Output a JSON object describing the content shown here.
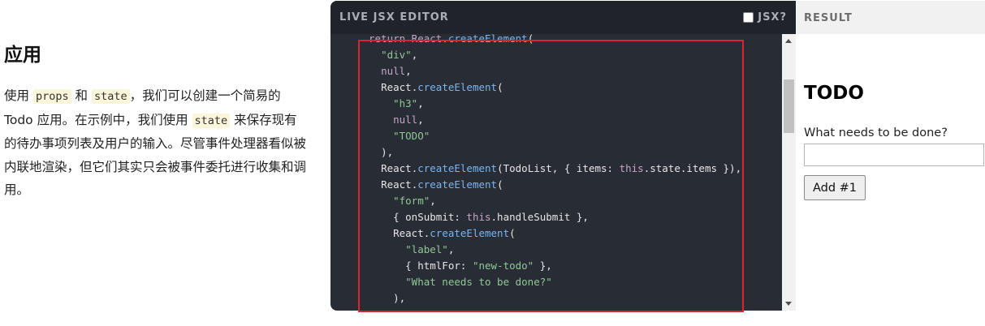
{
  "intro": {
    "heading": "应用",
    "p1": "使用 ",
    "code_props": "props",
    "p2": " 和 ",
    "code_state1": "state",
    "p3": "，我们可以创建一个简易的 Todo 应用。在示例中，我们使用 ",
    "code_state2": "state",
    "p4": " 来保存现有的待办事项列表及用户的输入。尽管事件处理器看似被内联地渲染，但它们其实只会被事件委托进行收集和调用。"
  },
  "editor": {
    "title": "LIVE JSX EDITOR",
    "jsx_toggle_label": "JSX?",
    "jsx_checked": false,
    "code": {
      "l1a": "return React.",
      "l1b": "createElement",
      "l1c": "(",
      "l2": "\"div\"",
      "l2c": ",",
      "l3": "null",
      "l3c": ",",
      "l4a": "React.",
      "l4b": "createElement",
      "l4c": "(",
      "l5": "\"h3\"",
      "l5c": ",",
      "l6": "null",
      "l6c": ",",
      "l7": "\"TODO\"",
      "l8": "),",
      "l9a": "React.",
      "l9b": "createElement",
      "l9c": "(TodoList, { items: ",
      "l9d": "this",
      "l9e": ".state.items }),",
      "l10a": "React.",
      "l10b": "createElement",
      "l10c": "(",
      "l11": "\"form\"",
      "l11c": ",",
      "l12a": "{ onSubmit: ",
      "l12b": "this",
      "l12c": ".handleSubmit },",
      "l13a": "React.",
      "l13b": "createElement",
      "l13c": "(",
      "l14": "\"label\"",
      "l14c": ",",
      "l15a": "{ htmlFor: ",
      "l15b": "\"new-todo\"",
      "l15c": " },",
      "l16": "\"What needs to be done?\"",
      "l17": "),"
    }
  },
  "result": {
    "title": "RESULT",
    "heading": "TODO",
    "label": "What needs to be done?",
    "input_value": "",
    "button_label": "Add #1"
  },
  "colors": {
    "editor_bg": "#282c34",
    "editor_header": "#20232a",
    "highlight_border": "#d9262e",
    "string": "#8fc895",
    "function": "#79b6f2",
    "keyword": "#c5a5c5"
  }
}
